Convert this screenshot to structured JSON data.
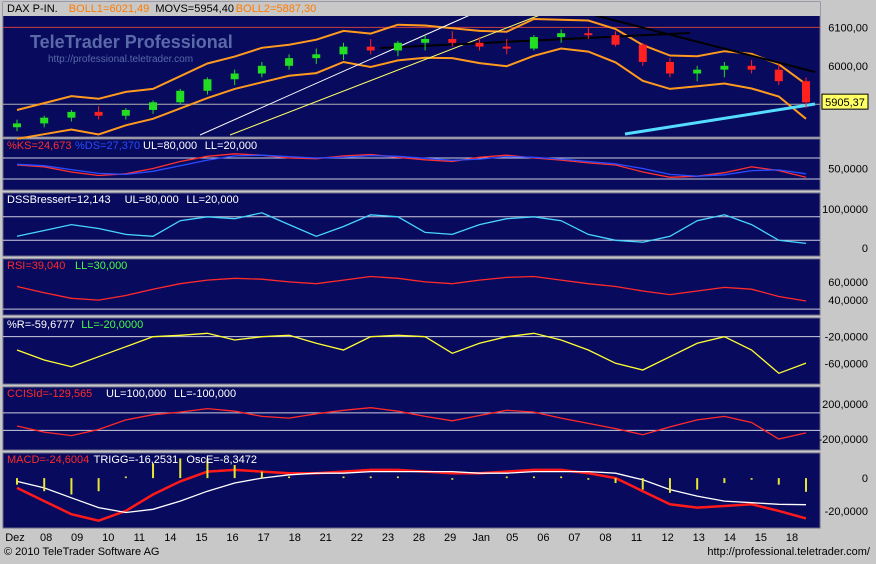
{
  "colors": {
    "panel_bg": "#080a5e",
    "frame": "#c8c8c8",
    "candle_up": "#22dd22",
    "candle_down": "#ff2020",
    "bollinger": "#ff9a1e",
    "ks": "#ff3030",
    "ds": "#2a4cff",
    "dss": "#47d6ff",
    "rsi": "#ff2a2a",
    "willr": "#ffff33",
    "cci": "#ff2a2a",
    "macd": "#ff1a1a",
    "trigg": "#ffffff",
    "osc": "#e6e633",
    "guide": "#ffffff",
    "label_green": "#44ff44"
  },
  "watermark": {
    "brand": "TeleTrader Professional",
    "url": "http://professional.teletrader.com"
  },
  "footer": {
    "copyright": "© 2010 TeleTrader Software AG",
    "url": "http://professional.teletrader.com/"
  },
  "chart_data": [
    {
      "type": "candlestick",
      "legend": [
        {
          "text": "DAX P-IN.",
          "color": "#000000"
        },
        {
          "text": "BOLL1=6021,49",
          "color": "#ff7a00"
        },
        {
          "text": "MOVS=5954,40",
          "color": "#000000"
        },
        {
          "text": "BOLL2=5887,30",
          "color": "#ff7a00"
        }
      ],
      "y_ticks": [
        "6100,00",
        "6000,00",
        "5900,00"
      ],
      "y_tick_values": [
        6100,
        6000,
        5900
      ],
      "ylim": [
        5825,
        6135
      ],
      "last_price_label": "5905,37",
      "last_price": 5905.37,
      "x_dates": [
        "Dez",
        "08",
        "09",
        "10",
        "11",
        "14",
        "15",
        "16",
        "17",
        "18",
        "21",
        "22",
        "23",
        "28",
        "29",
        "Jan",
        "05",
        "06",
        "07",
        "08",
        "11",
        "12",
        "13",
        "14",
        "15",
        "18"
      ],
      "candles_ohlc_approx": [
        [
          5840,
          5860,
          5830,
          5850
        ],
        [
          5850,
          5870,
          5840,
          5865
        ],
        [
          5865,
          5885,
          5855,
          5880
        ],
        [
          5880,
          5895,
          5860,
          5870
        ],
        [
          5870,
          5890,
          5860,
          5885
        ],
        [
          5885,
          5910,
          5875,
          5905
        ],
        [
          5905,
          5940,
          5900,
          5935
        ],
        [
          5935,
          5970,
          5925,
          5965
        ],
        [
          5965,
          5990,
          5950,
          5980
        ],
        [
          5980,
          6010,
          5970,
          6000
        ],
        [
          6000,
          6030,
          5990,
          6020
        ],
        [
          6020,
          6045,
          6005,
          6030
        ],
        [
          6030,
          6060,
          6015,
          6050
        ],
        [
          6050,
          6070,
          6030,
          6040
        ],
        [
          6040,
          6065,
          6025,
          6060
        ],
        [
          6060,
          6080,
          6040,
          6070
        ],
        [
          6070,
          6090,
          6050,
          6060
        ],
        [
          6060,
          6075,
          6040,
          6050
        ],
        [
          6050,
          6070,
          6030,
          6045
        ],
        [
          6045,
          6080,
          6040,
          6075
        ],
        [
          6075,
          6095,
          6060,
          6085
        ],
        [
          6085,
          6100,
          6070,
          6080
        ],
        [
          6080,
          6090,
          6050,
          6055
        ],
        [
          6055,
          6060,
          6000,
          6010
        ],
        [
          6010,
          6020,
          5970,
          5980
        ],
        [
          5980,
          6000,
          5960,
          5990
        ],
        [
          5990,
          6010,
          5970,
          6000
        ],
        [
          6000,
          6015,
          5980,
          5990
        ],
        [
          5990,
          6005,
          5950,
          5960
        ],
        [
          5960,
          5970,
          5890,
          5905
        ]
      ]
    },
    {
      "type": "line",
      "legend": [
        {
          "text": "%KS=24,673",
          "color": "#ff3030"
        },
        {
          "text": "%DS=27,370",
          "color": "#2a4cff"
        },
        {
          "text": "UL=80,000",
          "color": "#ffffff"
        },
        {
          "text": "LL=20,000",
          "color": "#ffffff"
        }
      ],
      "y_ticks": [
        "50,0000"
      ],
      "y_tick_values": [
        50
      ],
      "ylim": [
        0,
        100
      ],
      "bands": [
        80,
        20
      ],
      "series": [
        {
          "name": "%KS",
          "color": "#ff3030",
          "values": [
            60,
            55,
            40,
            30,
            35,
            50,
            70,
            85,
            92,
            88,
            80,
            78,
            86,
            90,
            82,
            75,
            70,
            82,
            88,
            80,
            74,
            66,
            60,
            40,
            25,
            28,
            38,
            55,
            44,
            25
          ]
        },
        {
          "name": "%DS",
          "color": "#2a4cff",
          "values": [
            62,
            58,
            47,
            36,
            33,
            42,
            58,
            74,
            86,
            88,
            84,
            80,
            82,
            87,
            85,
            79,
            73,
            77,
            84,
            82,
            77,
            70,
            63,
            50,
            33,
            28,
            32,
            44,
            46,
            35
          ]
        }
      ]
    },
    {
      "type": "line",
      "legend": [
        {
          "text": "DSSBressert=12,143",
          "color": "#ffffff"
        },
        {
          "text": "UL=80,000",
          "color": "#ffffff"
        },
        {
          "text": "LL=20,000",
          "color": "#ffffff"
        }
      ],
      "y_ticks": [
        "100,0000",
        "0"
      ],
      "y_tick_values": [
        100,
        0
      ],
      "ylim": [
        -10,
        110
      ],
      "bands": [
        80,
        20
      ],
      "series": [
        {
          "name": "DSSBressert",
          "color": "#47d6ff",
          "values": [
            30,
            45,
            60,
            50,
            35,
            30,
            70,
            80,
            75,
            90,
            60,
            30,
            55,
            85,
            80,
            40,
            35,
            60,
            75,
            80,
            70,
            35,
            20,
            15,
            30,
            70,
            85,
            60,
            20,
            12
          ]
        }
      ]
    },
    {
      "type": "line",
      "legend": [
        {
          "text": "RSI=39,040",
          "color": "#ff2a2a"
        },
        {
          "text": "LL=30,000",
          "color": "#44ff44"
        }
      ],
      "y_ticks": [
        "60,0000",
        "40,0000"
      ],
      "y_tick_values": [
        60,
        40
      ],
      "ylim": [
        28,
        72
      ],
      "bands": [
        30
      ],
      "series": [
        {
          "name": "RSI",
          "color": "#ff2a2a",
          "values": [
            55,
            48,
            42,
            40,
            45,
            52,
            58,
            62,
            64,
            63,
            60,
            58,
            62,
            66,
            64,
            60,
            58,
            62,
            65,
            66,
            62,
            58,
            55,
            50,
            46,
            50,
            54,
            52,
            44,
            39
          ]
        }
      ]
    },
    {
      "type": "line",
      "legend": [
        {
          "text": "%R=-59,6777",
          "color": "#ffffff"
        },
        {
          "text": "LL=-20,0000",
          "color": "#44ff44"
        }
      ],
      "y_ticks": [
        "-20,0000",
        "-60,0000"
      ],
      "y_tick_values": [
        -20,
        -60
      ],
      "ylim": [
        -85,
        -10
      ],
      "bands": [
        -20
      ],
      "series": [
        {
          "name": "%R",
          "color": "#ffff33",
          "values": [
            -40,
            -55,
            -65,
            -50,
            -35,
            -20,
            -18,
            -15,
            -25,
            -20,
            -18,
            -30,
            -40,
            -20,
            -18,
            -20,
            -45,
            -30,
            -20,
            -15,
            -25,
            -40,
            -60,
            -70,
            -50,
            -30,
            -20,
            -40,
            -75,
            -59.6777
          ]
        }
      ]
    },
    {
      "type": "line",
      "legend": [
        {
          "text": "CCISId=-129,565",
          "color": "#ff2a2a"
        },
        {
          "text": "UL=100,000",
          "color": "#ffffff"
        },
        {
          "text": "LL=-100,000",
          "color": "#ffffff"
        }
      ],
      "y_ticks": [
        "200,0000",
        "-200,0000"
      ],
      "y_tick_values": [
        200,
        -200
      ],
      "ylim": [
        -280,
        260
      ],
      "bands": [
        100,
        -100
      ],
      "series": [
        {
          "name": "CCISId",
          "color": "#ff2a2a",
          "values": [
            -50,
            -120,
            -160,
            -90,
            20,
            80,
            110,
            150,
            120,
            60,
            40,
            90,
            130,
            160,
            120,
            60,
            10,
            70,
            130,
            110,
            40,
            -20,
            -80,
            -150,
            -60,
            20,
            60,
            -10,
            -200,
            -129.565
          ]
        }
      ]
    },
    {
      "type": "line",
      "legend": [
        {
          "text": "MACD=-24,6004",
          "color": "#ff2a2a"
        },
        {
          "text": "TRIGG=-16,2531",
          "color": "#ffffff"
        },
        {
          "text": "OscE=-8,3472",
          "color": "#ffffff"
        }
      ],
      "y_ticks": [
        "0",
        "-20,0000"
      ],
      "y_tick_values": [
        0,
        -20
      ],
      "ylim": [
        -28,
        8
      ],
      "series": [
        {
          "name": "MACD",
          "color": "#ff1a1a",
          "values": [
            -6,
            -14,
            -22,
            -26,
            -20,
            -10,
            -2,
            4,
            5,
            4,
            3,
            3,
            4,
            5,
            5,
            4,
            3,
            3,
            4,
            5,
            5,
            3,
            0,
            -8,
            -16,
            -18,
            -17,
            -16,
            -20,
            -24.6004
          ]
        },
        {
          "name": "TRIGG",
          "color": "#ffffff",
          "values": [
            -2,
            -6,
            -12,
            -18,
            -21,
            -19,
            -14,
            -8,
            -3,
            0,
            2,
            3,
            3,
            4,
            4,
            4,
            4,
            3,
            3,
            4,
            4,
            4,
            3,
            -1,
            -7,
            -11,
            -14,
            -15,
            -16,
            -16.2531
          ]
        },
        {
          "name": "OscE",
          "color": "#e6e633",
          "values": [
            -4,
            -8,
            -10,
            -8,
            1,
            9,
            12,
            12,
            8,
            4,
            1,
            0,
            1,
            1,
            1,
            0,
            -1,
            0,
            1,
            1,
            1,
            -1,
            -3,
            -7,
            -9,
            -7,
            -3,
            -1,
            -4,
            -8.3472
          ]
        }
      ]
    }
  ]
}
